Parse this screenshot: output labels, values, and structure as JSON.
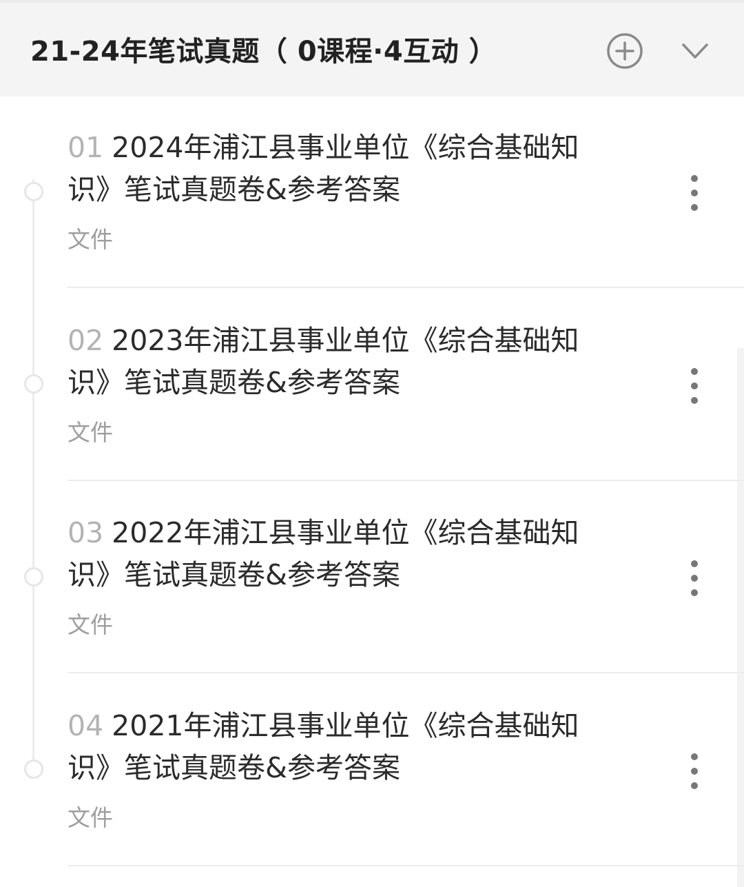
{
  "section": {
    "title": "21-24年笔试真题（ 0课程·4互动 ）"
  },
  "items": [
    {
      "number": "01",
      "title": "2024年浦江县事业单位《综合基础知识》笔试真题卷&参考答案",
      "type": "文件"
    },
    {
      "number": "02",
      "title": "2023年浦江县事业单位《综合基础知识》笔试真题卷&参考答案",
      "type": "文件"
    },
    {
      "number": "03",
      "title": "2022年浦江县事业单位《综合基础知识》笔试真题卷&参考答案",
      "type": "文件"
    },
    {
      "number": "04",
      "title": "2021年浦江县事业单位《综合基础知识》笔试真题卷&参考答案",
      "type": "文件"
    }
  ],
  "icons": {
    "add": "plus-circle-icon",
    "collapse": "chevron-down-icon",
    "more": "more-vertical-icon"
  },
  "colors": {
    "header_bg": "#f4f4f4",
    "title_text": "#222222",
    "number_text": "#b3b3b3",
    "meta_text": "#9e9e9e",
    "divider": "#ececec"
  }
}
